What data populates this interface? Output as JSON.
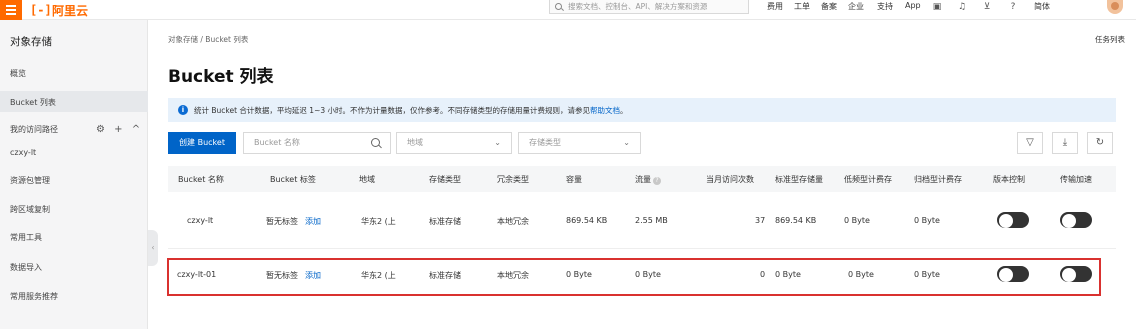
{
  "header": {
    "logo_mark": "[-]",
    "logo_text": "阿里云",
    "search_placeholder": "搜索文档、控制台、API、解决方案和资源",
    "nav": [
      "费用",
      "工单",
      "备案",
      "企业",
      "支持",
      "App"
    ],
    "language": "简体",
    "icons": [
      "screen-icon",
      "bell-icon",
      "cart-icon",
      "help-icon"
    ]
  },
  "sidebar": {
    "title": "对象存储",
    "items": [
      {
        "label": "概览"
      },
      {
        "label": "Bucket 列表"
      },
      {
        "label": "我的访问路径"
      },
      {
        "label": "czxy-lt"
      },
      {
        "label": "资源包管理"
      },
      {
        "label": "跨区域复制"
      },
      {
        "label": "常用工具"
      },
      {
        "label": "数据导入"
      },
      {
        "label": "常用服务推荐"
      }
    ],
    "active": "Bucket 列表",
    "path_actions": "⚙ + ^"
  },
  "main": {
    "breadcrumb": "对象存储 / Bucket 列表",
    "task_list": "任务列表",
    "title": "Bucket 列表",
    "notice": {
      "text": "统计 Bucket 合计数据，平均延迟 1~3 小时。不作为计量数据，仅作参考。不同存储类型的存储用量计费规则，请参见",
      "link": "帮助文档",
      "tail": "。"
    },
    "create_button": "创建 Bucket",
    "filters": {
      "bucket_name_placeholder": "Bucket 名称",
      "region": "地域",
      "storage_type": "存储类型"
    },
    "table": {
      "headers": [
        "Bucket 名称",
        "Bucket 标签",
        "地域",
        "存储类型",
        "冗余类型",
        "容量",
        "流量",
        "当月访问次数",
        "标准型存储量",
        "低频型计费存",
        "归档型计费存",
        "版本控制",
        "传输加速"
      ],
      "rows": [
        {
          "name": "czxy-lt",
          "tag": "暂无标签",
          "tag_action": "添加",
          "region": "华东2 (上",
          "storage": "标准存储",
          "redundancy": "本地冗余",
          "capacity": "869.54 KB",
          "traffic": "2.55 MB",
          "visits": "37",
          "std": "869.54 KB",
          "ia": "0 Byte",
          "archive": "0 Byte",
          "versioning": false,
          "acceleration": false
        },
        {
          "name": "czxy-lt-01",
          "tag": "暂无标签",
          "tag_action": "添加",
          "region": "华东2 (上",
          "storage": "标准存储",
          "redundancy": "本地冗余",
          "capacity": "0 Byte",
          "traffic": "0 Byte",
          "visits": "0",
          "std": "0 Byte",
          "ia": "0 Byte",
          "archive": "0 Byte",
          "versioning": false,
          "acceleration": false
        }
      ]
    }
  },
  "colors": {
    "brand": "#ff6a00",
    "primary": "#0064c8",
    "highlight_border": "#d9312f"
  }
}
